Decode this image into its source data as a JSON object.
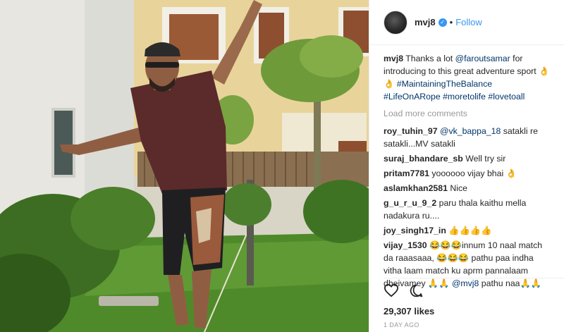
{
  "post": {
    "username": "mvj8",
    "verified_icon": "verified-badge-icon",
    "separator": "•",
    "follow_label": "Follow"
  },
  "caption": {
    "username": "mvj8",
    "text_1": "Thanks a lot ",
    "mention": "@faroutsamar",
    "text_2": " for introducing to this great adventure sport ",
    "emoji": "👌👌",
    "tags": [
      "#MaintainingTheBalance",
      "#LifeOnARope",
      "#moretolife",
      "#lovetoall"
    ]
  },
  "load_more_label": "Load more comments",
  "comments": [
    {
      "user": "roy_tuhin_97",
      "mention": "@vk_bappa_18",
      "text": " satakli re satakli...MV satakli"
    },
    {
      "user": "suraj_bhandare_sb",
      "text": " Well try sir"
    },
    {
      "user": "pritam7781",
      "text": " yoooooo vijay bhai 👌"
    },
    {
      "user": "aslamkhan2581",
      "text": " Nice"
    },
    {
      "user": "g_u_r_u_9_2",
      "text": " paru thala kaithu mella nadakura ru...."
    },
    {
      "user": "joy_singh17_in",
      "text": " 👍👍👍👍"
    },
    {
      "user": "vijay_1530",
      "text": " 😂😂😂innum 10 naal match da raaasaaa, 😂😂😂 pathu paa indha vitha laam match ku aprm pannalaam dheivamey 🙏🙏"
    },
    {
      "user": "",
      "mention": "@mvj8",
      "text": " pathu naa🙏🙏"
    }
  ],
  "actions": {
    "like_icon": "heart-icon",
    "comment_icon": "comment-icon"
  },
  "likes": "29,307 likes",
  "timestamp": "1 DAY AGO",
  "colors": {
    "link": "#003569",
    "accent": "#3897f0",
    "muted": "#999999"
  }
}
